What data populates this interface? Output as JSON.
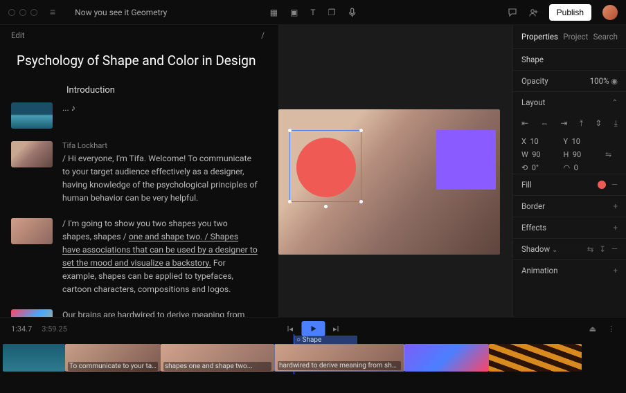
{
  "top": {
    "title": "Now you see it Geometry",
    "publish": "Publish"
  },
  "sub": {
    "edit": "Edit",
    "slash": "/"
  },
  "doc": {
    "title": "Psychology of Shape and Color in Design",
    "section": "Introduction",
    "ellips": "... ♪",
    "speaker": "Tifa Lockhart",
    "p1": "/ Hi everyone, I'm Tifa. Welcome! To communicate to your target audience effectively as a designer, having knowledge of the psychological principles of human behavior can be very helpful.",
    "p2a": "/ I'm going to show you two shapes you two shapes, shapes / ",
    "p2link": "one and shape two. / Shapes have associations that can be used by a designer to set the mood and visualize a backstory.",
    "p2b": " For example, shapes can be applied to typefaces, cartoon characters, compositions and logos.",
    "p3": "Our brains are hardwired to derive meaning from shapes, which have a bigger impact on our"
  },
  "props": {
    "tabs": [
      "Properties",
      "Project",
      "Search"
    ],
    "shapeHdr": "Shape",
    "opacity": "Opacity",
    "opacityVal": "100%",
    "layout": "Layout",
    "x": "X",
    "xv": "10",
    "y": "Y",
    "yv": "10",
    "w": "W",
    "wv": "90",
    "h": "H",
    "hv": "90",
    "rot": "⟲",
    "rotv": "0°",
    "corner": "◠",
    "cornerv": "0",
    "fill": "Fill",
    "border": "Border",
    "effects": "Effects",
    "shadow": "Shadow",
    "animation": "Animation"
  },
  "time": {
    "cur": "1:34.7",
    "dur": "3:59.25"
  },
  "clips": {
    "c2": "To communicate to your target audience...",
    "c3": "shapes one and shape two...",
    "c4": "hardwired to derive meaning from shapes, which have a bigger impact on our s",
    "shape": "Shape"
  }
}
